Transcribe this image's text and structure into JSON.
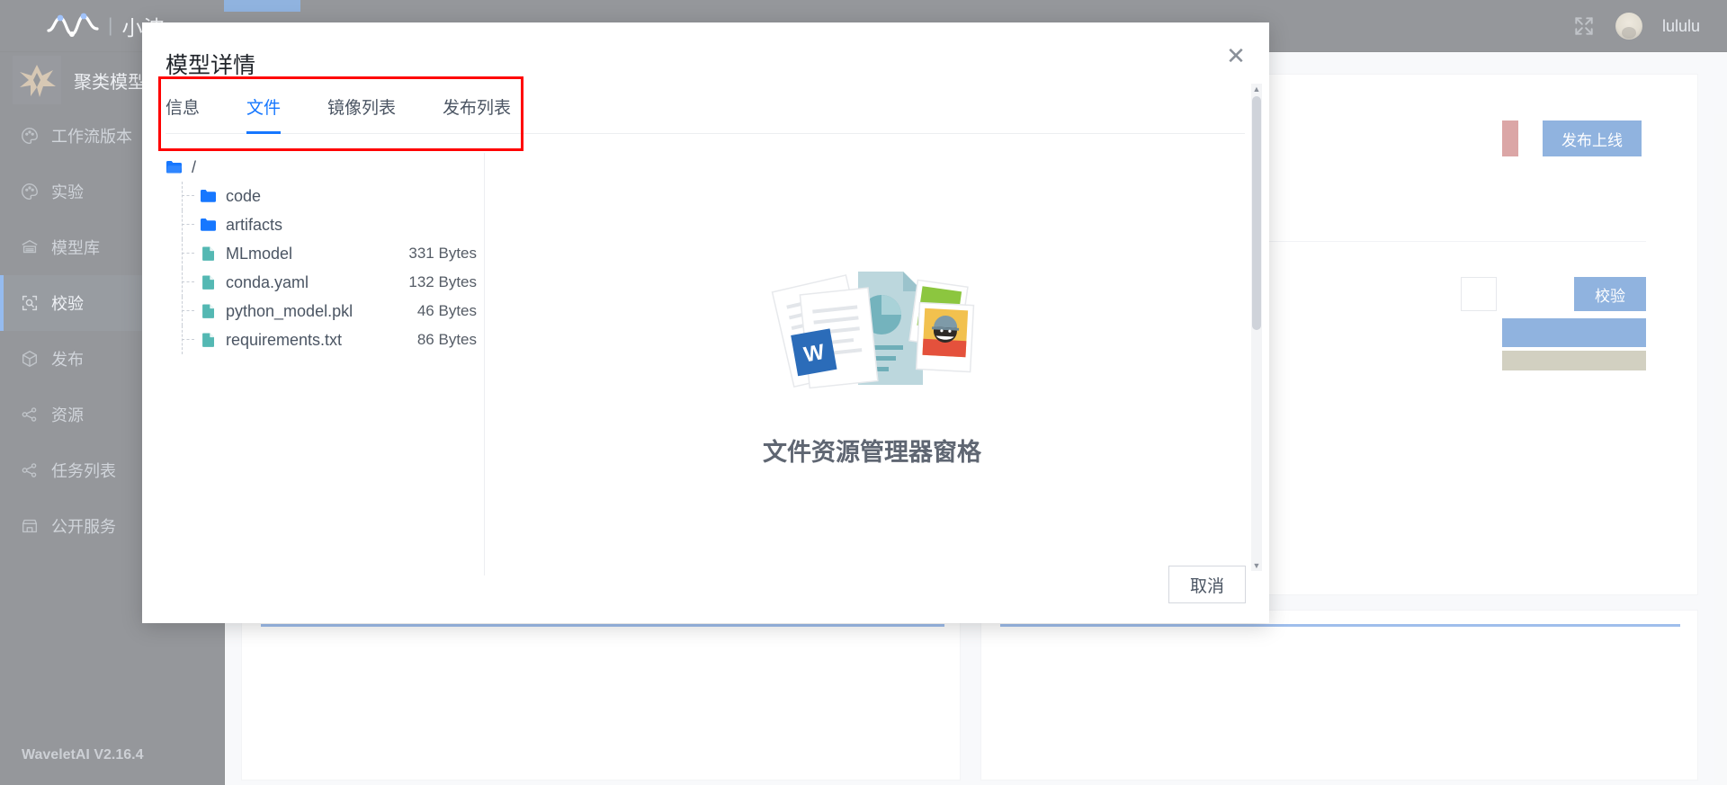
{
  "topbar": {
    "brand_divider": "|",
    "brand_name": "小波",
    "username": "lululu",
    "expand_icon": "expand-arrows-icon",
    "avatar_icon": "avatar"
  },
  "sidebar": {
    "header_title": "聚类模型",
    "version": "WaveletAI V2.16.4",
    "items": [
      {
        "label": "工作流版本",
        "icon": "palette-icon",
        "active": false
      },
      {
        "label": "实验",
        "icon": "palette-icon",
        "active": false
      },
      {
        "label": "模型库",
        "icon": "database-icon",
        "active": false
      },
      {
        "label": "校验",
        "icon": "scan-icon",
        "active": true
      },
      {
        "label": "发布",
        "icon": "cube-icon",
        "active": false
      },
      {
        "label": "资源",
        "icon": "share-nodes-icon",
        "active": false
      },
      {
        "label": "任务列表",
        "icon": "share-nodes-icon",
        "active": false
      },
      {
        "label": "公开服务",
        "icon": "store-icon",
        "active": false
      }
    ]
  },
  "background_page": {
    "publish_button": "发布上线",
    "verify_button": "校验"
  },
  "modal": {
    "title": "模型详情",
    "close_icon": "close-icon",
    "tabs": [
      {
        "label": "信息",
        "active": false
      },
      {
        "label": "文件",
        "active": true
      },
      {
        "label": "镜像列表",
        "active": false
      },
      {
        "label": "发布列表",
        "active": false
      }
    ],
    "highlight_color": "#ff0000",
    "accent_color": "#1677ff",
    "file_tree": [
      {
        "name": "/",
        "type": "folder",
        "size": "",
        "depth": 0
      },
      {
        "name": "code",
        "type": "folder",
        "size": "",
        "depth": 1
      },
      {
        "name": "artifacts",
        "type": "folder",
        "size": "",
        "depth": 1
      },
      {
        "name": "MLmodel",
        "type": "file",
        "size": "331 Bytes",
        "depth": 1
      },
      {
        "name": "conda.yaml",
        "type": "file",
        "size": "132 Bytes",
        "depth": 1
      },
      {
        "name": "python_model.pkl",
        "type": "file",
        "size": "46 Bytes",
        "depth": 1
      },
      {
        "name": "requirements.txt",
        "type": "file",
        "size": "86 Bytes",
        "depth": 1
      }
    ],
    "empty_state": {
      "caption": "文件资源管理器窗格",
      "illustration": "documents-and-photos-illustration",
      "word_badge": "W"
    },
    "scrollbar": {
      "up_icon": "chevron-up-icon",
      "down_icon": "chevron-down-icon"
    },
    "cancel_button": "取消"
  },
  "colors": {
    "folder_blue": "#1677ff",
    "file_teal": "#54b8b3",
    "primary_blue": "#0b57b8",
    "sidebar_bg": "#141a22"
  }
}
